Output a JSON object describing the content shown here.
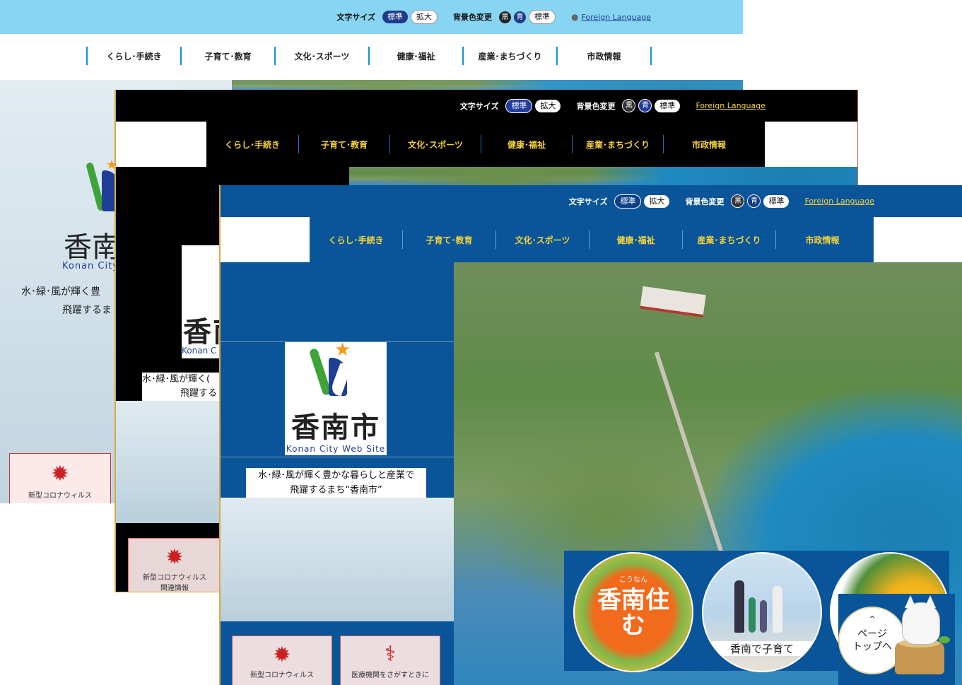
{
  "topbar": {
    "font_size_label": "文字サイズ",
    "font_size_options": [
      "標準",
      "拡大"
    ],
    "bg_color_label": "背景色変更",
    "bg_options": [
      "黒",
      "青",
      "標準"
    ],
    "foreign_language": "Foreign Language"
  },
  "nav": [
    "くらし･手続き",
    "子育て･教育",
    "文化･スポーツ",
    "健康･福祉",
    "産業･まちづくり",
    "市政情報"
  ],
  "logo": {
    "title": "香南市",
    "subtitle": "Konan City Web Site",
    "subtitle_short": "Konan City",
    "subtitle_cut": "Konan C"
  },
  "slogan": {
    "line1": "水･緑･風が輝く豊かな暮らしと産業で",
    "line2": "飛躍するまち“香南市”",
    "line1_cut1": "水･緑･風が輝く豊",
    "line2_cut1": "飛躍するま",
    "line1_cut2": "水･緑･風が輝く(",
    "line2_cut2": "飛躍する"
  },
  "cards": {
    "covid_line1": "新型コロナウィルス",
    "covid_line2": "関連情報",
    "medical_line": "医療機関をさがすときに"
  },
  "badges": {
    "live": "香南住む",
    "live_top": "こうなん",
    "raise": "香南で子育て"
  },
  "page_top": {
    "line1": "ページ",
    "line2": "トップへ"
  },
  "colors": {
    "standard_header": "#87d5f3",
    "black_theme": "#000000",
    "blue_theme": "#0a5599",
    "nav_text_contrast": "#f5d23a"
  }
}
